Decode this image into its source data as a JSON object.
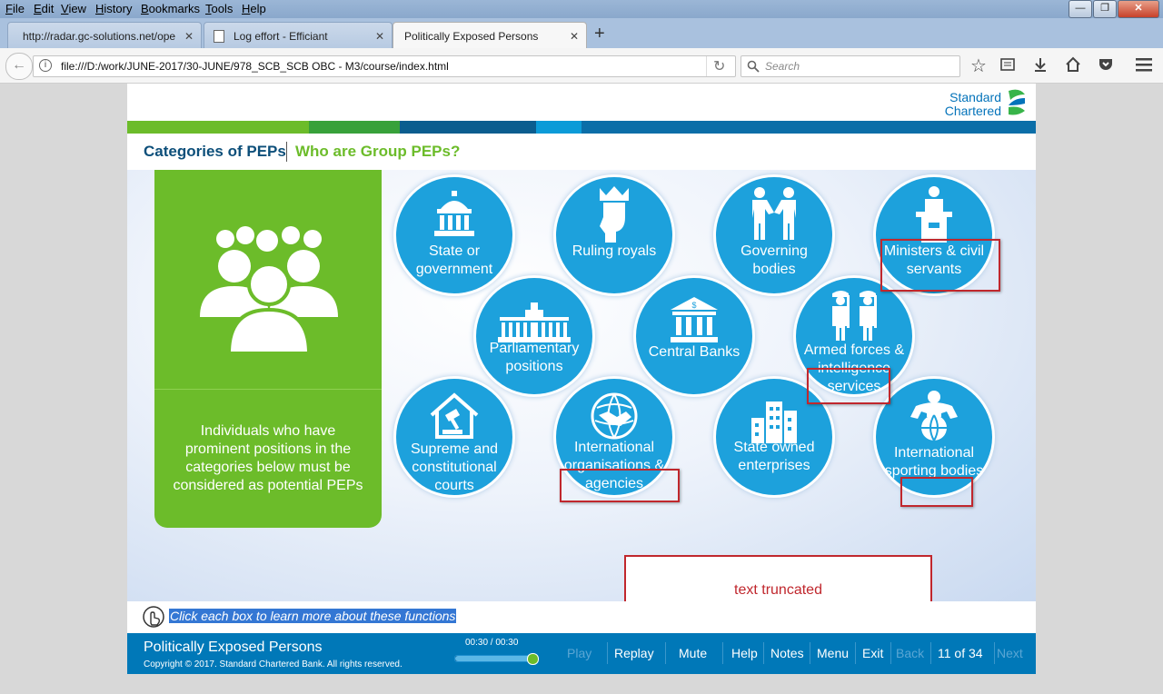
{
  "menubar": {
    "items": [
      "File",
      "Edit",
      "View",
      "History",
      "Bookmarks",
      "Tools",
      "Help"
    ]
  },
  "tabs": [
    {
      "label": "http://radar.gc-solutions.net/ope"
    },
    {
      "label": "Log effort - Efficiant"
    },
    {
      "label": "Politically Exposed Persons"
    }
  ],
  "navbar": {
    "url": "file:///D:/work/JUNE-2017/30-JUNE/978_SCB_SCB OBC - M3/course/index.html",
    "search_placeholder": "Search"
  },
  "course": {
    "logo_line1": "Standard",
    "logo_line2": "Chartered",
    "breadcrumb_primary": "Categories of PEPs",
    "breadcrumb_secondary": "Who are Group PEPs?",
    "panel_text": "Individuals who have prominent positions in the categories below must be considered as potential PEPs",
    "categories": [
      {
        "label": "State or government",
        "icon": "capitol-building-icon"
      },
      {
        "label": "Ruling royals",
        "icon": "crowned-king-icon"
      },
      {
        "label": "Governing bodies",
        "icon": "handshake-people-icon"
      },
      {
        "label": "Ministers & civil servants",
        "icon": "podium-speaker-icon"
      },
      {
        "label": "Parliamentary positions",
        "icon": "parliament-building-icon"
      },
      {
        "label": "Central Banks",
        "icon": "bank-building-icon"
      },
      {
        "label": "Armed forces & intelligence services",
        "icon": "soldiers-icon"
      },
      {
        "label": "Supreme and constitutional courts",
        "icon": "gavel-house-icon"
      },
      {
        "label": "International organisations & agencies",
        "icon": "globe-handshake-icon"
      },
      {
        "label": "State owned enterprises",
        "icon": "office-buildings-icon"
      },
      {
        "label": "International sporting bodies",
        "icon": "athlete-globe-icon"
      }
    ],
    "annotation": "text truncated",
    "instruction": "Click each box to learn more about these functions",
    "footer": {
      "course_title": "Politically Exposed Persons",
      "copyright": "Copyright © 2017. Standard Chartered Bank. All rights reserved.",
      "time": "00:30 / 00:30",
      "progress": 1.0,
      "buttons": [
        "Play",
        "Replay",
        "Mute",
        "Help",
        "Notes",
        "Menu",
        "Exit",
        "Back"
      ],
      "page_indicator": "11 of 34",
      "next": "Next"
    }
  },
  "colors": {
    "brand_blue": "#0078b8",
    "circle_blue": "#1da1dc",
    "brand_green": "#6cbc2a",
    "annotation_red": "#c0272d"
  }
}
